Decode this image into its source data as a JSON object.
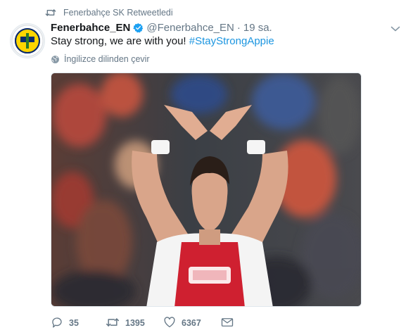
{
  "retweet_context": {
    "text": "Fenerbahçe SK Retweetledi"
  },
  "tweet": {
    "display_name": "Fenerbahce_EN",
    "handle": "@Fenerbahce_EN",
    "separator": "·",
    "timestamp": "19 sa.",
    "text_plain": "Stay strong, we are with you! ",
    "hashtag": "#StayStrongAppie",
    "translate_label": "İngilizce dilinden çevir",
    "media_alt": ""
  },
  "actions": {
    "replies": "35",
    "retweets": "1395",
    "likes": "6367"
  },
  "icons": {
    "retweet_context": "retweet-icon",
    "verified": "verified-badge-icon",
    "caret": "chevron-down-icon",
    "globe": "globe-icon",
    "reply": "reply-icon",
    "retweet": "retweet-icon",
    "like": "heart-icon",
    "dm": "envelope-icon"
  },
  "colors": {
    "accent": "#1b95e0",
    "muted": "#657786",
    "text": "#14171a",
    "verified": "#1da1f2"
  }
}
